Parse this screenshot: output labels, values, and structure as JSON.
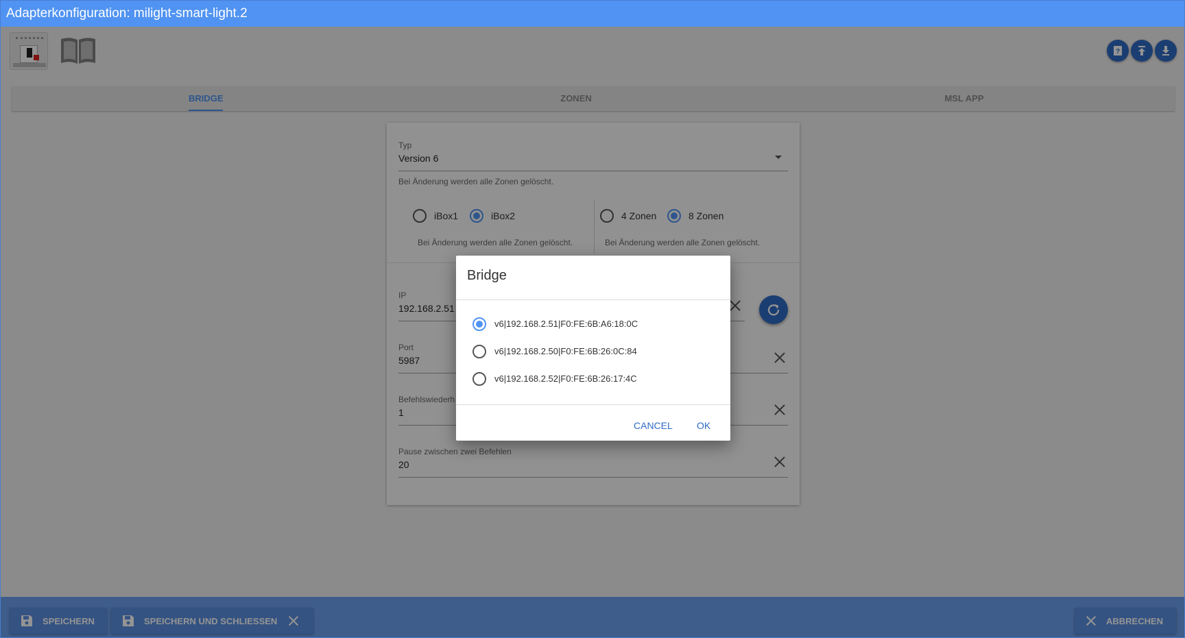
{
  "window": {
    "title": "Adapterkonfiguration: milight-smart-light.2"
  },
  "tabs": [
    {
      "label": "BRIDGE",
      "active": true
    },
    {
      "label": "ZONEN",
      "active": false
    },
    {
      "label": "MSL APP",
      "active": false
    }
  ],
  "form": {
    "typ": {
      "label": "Typ",
      "value": "Version 6",
      "helper": "Bei Änderung werden alle Zonen gelöscht."
    },
    "box": {
      "options": [
        "iBox1",
        "iBox2"
      ],
      "selected": "iBox2",
      "helper": "Bei Änderung werden alle Zonen gelöscht."
    },
    "zonen": {
      "options": [
        "4 Zonen",
        "8 Zonen"
      ],
      "selected": "8 Zonen",
      "helper": "Bei Änderung werden alle Zonen gelöscht."
    },
    "ip": {
      "label": "IP",
      "value": "192.168.2.51"
    },
    "port": {
      "label": "Port",
      "value": "5987"
    },
    "repeat": {
      "label": "Befehlswiederh",
      "value": "1"
    },
    "pause": {
      "label": "Pause zwischen zwei Befehlen",
      "value": "20"
    }
  },
  "dialog": {
    "title": "Bridge",
    "options": [
      "v6|192.168.2.51|F0:FE:6B:A6:18:0C",
      "v6|192.168.2.50|F0:FE:6B:26:0C:84",
      "v6|192.168.2.52|F0:FE:6B:26:17:4C"
    ],
    "selected_index": 0,
    "cancel_label": "CANCEL",
    "ok_label": "OK"
  },
  "footer": {
    "save_label": "SPEICHERN",
    "save_close_label": "SPEICHERN UND SCHLIESSEN",
    "cancel_label": "ABBRECHEN"
  },
  "colors": {
    "accent": "#5093f2",
    "dark_accent": "#2f6bc4"
  }
}
